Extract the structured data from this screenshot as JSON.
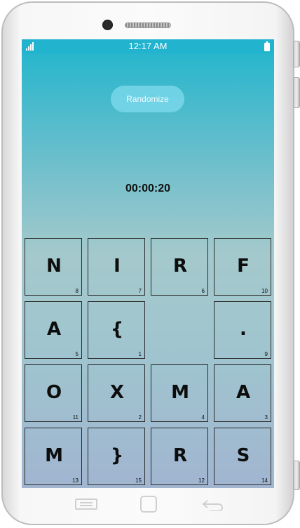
{
  "device": {
    "camera_icon": "front-camera-icon",
    "speaker_icon": "earpiece-speaker-icon"
  },
  "status_bar": {
    "time": "12:17 AM",
    "signal_icon": "signal-bars-icon",
    "battery_icon": "battery-icon"
  },
  "puzzle": {
    "randomize_label": "Randomize",
    "timer": "00:00:20",
    "tiles": [
      {
        "letter": "N",
        "number": "8"
      },
      {
        "letter": "I",
        "number": "7"
      },
      {
        "letter": "R",
        "number": "6"
      },
      {
        "letter": "F",
        "number": "10"
      },
      {
        "letter": "A",
        "number": "5"
      },
      {
        "letter": "{",
        "number": "1"
      },
      null,
      {
        "letter": ".",
        "number": "9"
      },
      {
        "letter": "O",
        "number": "11"
      },
      {
        "letter": "X",
        "number": "2"
      },
      {
        "letter": "M",
        "number": "4"
      },
      {
        "letter": "A",
        "number": "3"
      },
      {
        "letter": "M",
        "number": "13"
      },
      {
        "letter": "}",
        "number": "15"
      },
      {
        "letter": "R",
        "number": "12"
      },
      {
        "letter": "S",
        "number": "14"
      }
    ]
  },
  "nav_bar": {
    "menu_icon": "recent-apps-icon",
    "home_icon": "home-icon",
    "back_icon": "back-arrow-icon"
  },
  "colors": {
    "status_bar": "#22b4cf",
    "button": "#76d6e8",
    "tile_border": "#2a2a2a"
  }
}
